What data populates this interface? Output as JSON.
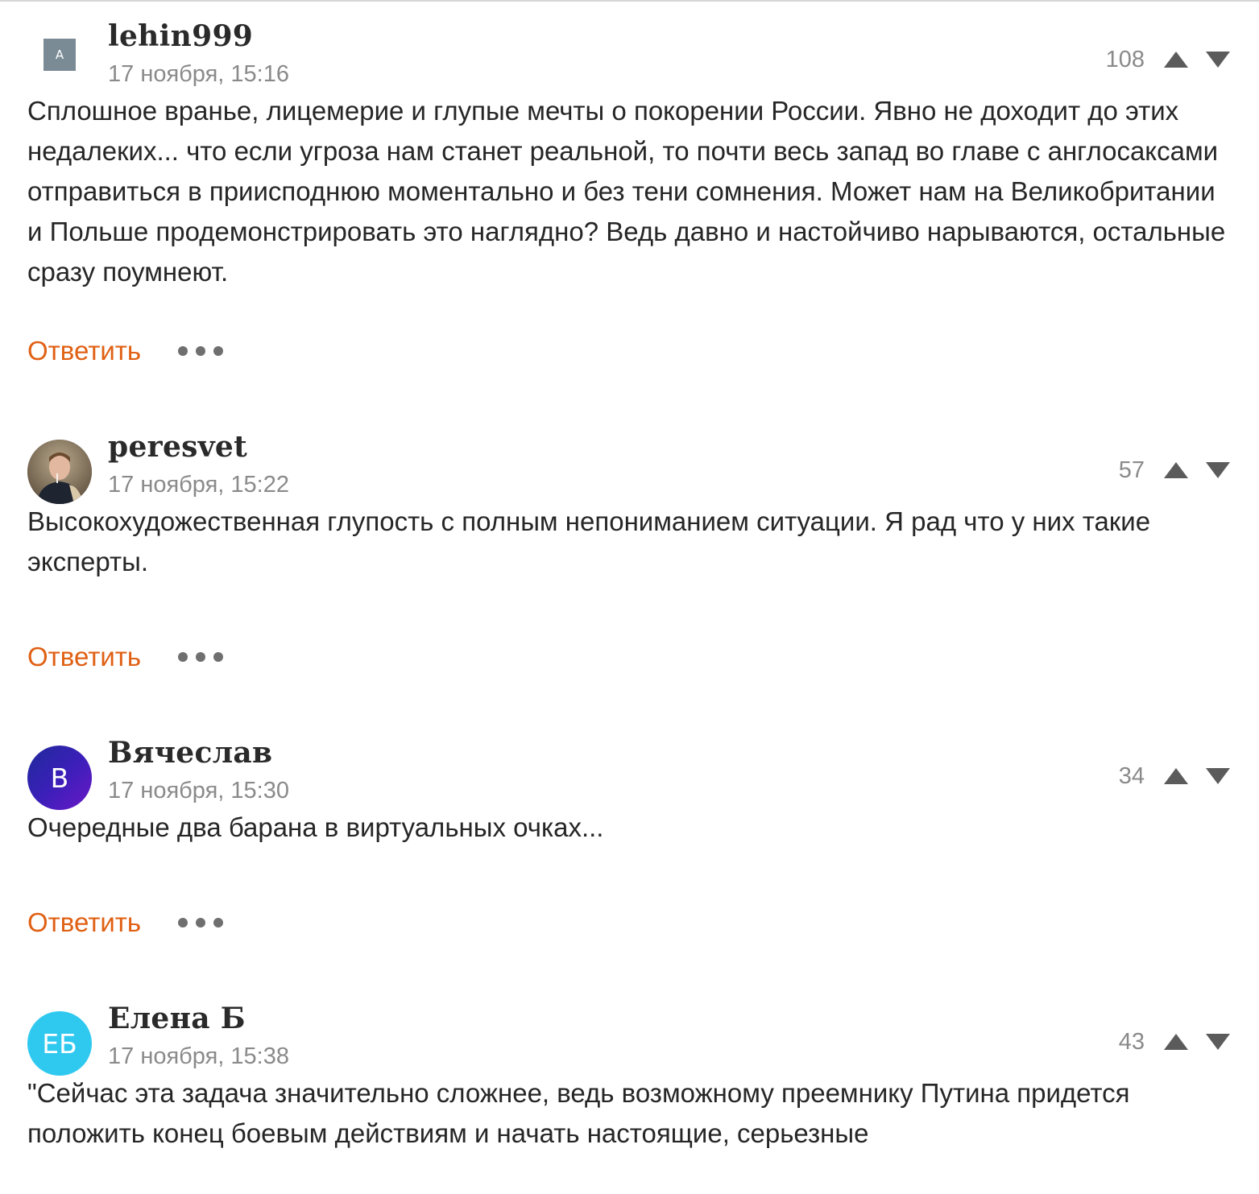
{
  "colors": {
    "accent_reply": "#e06014",
    "meta_gray": "#8a8a8a",
    "avatar_lehin": "#7a8b95",
    "avatar_vyacheslav_from": "#1f2a9a",
    "avatar_vyacheslav_to": "#6a18c8",
    "avatar_elena": "#2fc9f0"
  },
  "icons": {
    "vote_up": "triangle-up-icon",
    "vote_down": "triangle-down-icon",
    "more": "more-dots-icon"
  },
  "comments": [
    {
      "author": "lehin999",
      "avatar_initials": "A",
      "date": "17 ноября, 15:16",
      "score": "108",
      "text": "Сплошное вранье, лицемерие и глупые мечты о покорении России. Явно не доходит до этих недалеких... что если угроза нам станет реальной, то почти весь запад во главе с англосаксами отправиться в приисподнюю моментально и без тени сомнения. Может нам на Великобритании и Польше продемонстрировать это наглядно? Ведь давно и настойчиво нарываются, остальные сразу поумнеют.",
      "reply_label": "Ответить"
    },
    {
      "author": "peresvet",
      "avatar_initials": "",
      "date": "17 ноября, 15:22",
      "score": "57",
      "text": "Высокохудожественная глупость с полным непониманием ситуации. Я рад что у них такие эксперты.",
      "reply_label": "Ответить"
    },
    {
      "author": "Вячеслав",
      "avatar_initials": "В",
      "date": "17 ноября, 15:30",
      "score": "34",
      "text": "Очередные два барана в виртуальных очках...",
      "reply_label": "Ответить"
    },
    {
      "author": "Елена Б",
      "avatar_initials": "ЕБ",
      "date": "17 ноября, 15:38",
      "score": "43",
      "text": "\"Сейчас эта задача значительно сложнее, ведь возможному преемнику Путина придется положить конец боевым действиям и начать настоящие, серьезные",
      "reply_label": ""
    }
  ]
}
